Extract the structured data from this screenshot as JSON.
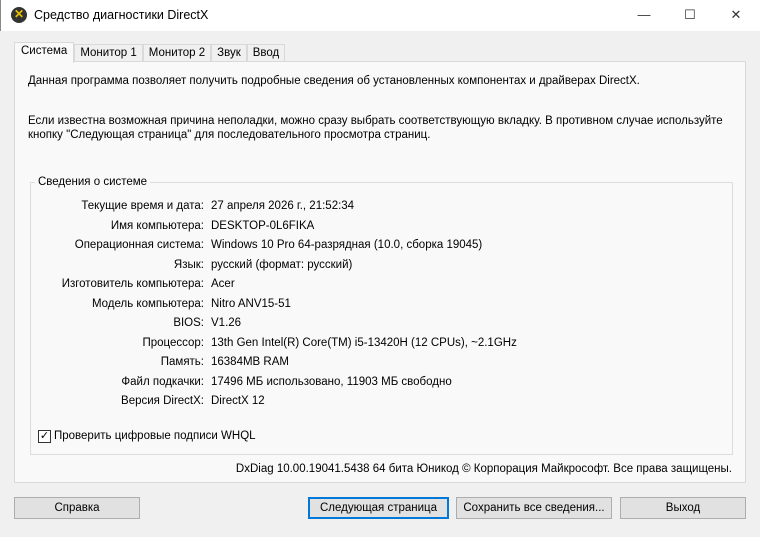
{
  "window": {
    "title": "Средство диагностики DirectX",
    "minimize": "—",
    "maximize": "☐",
    "close": "✕"
  },
  "tabs": [
    "Система",
    "Монитор 1",
    "Монитор 2",
    "Звук",
    "Ввод"
  ],
  "intro": "Данная программа позволяет получить подробные сведения об установленных компонентах и драйверах DirectX.",
  "hint": "Если известна возможная причина неполадки, можно сразу выбрать соответствующую вкладку. В противном случае используйте кнопку \"Следующая страница\" для последовательного просмотра страниц.",
  "group_title": "Сведения о системе",
  "rows": [
    {
      "label": "Текущие время и дата:",
      "value": "27 апреля 2026 г., 21:52:34"
    },
    {
      "label": "Имя компьютера:",
      "value": "DESKTOP-0L6FIKA"
    },
    {
      "label": "Операционная система:",
      "value": "Windows 10 Pro 64-разрядная (10.0, сборка 19045)"
    },
    {
      "label": "Язык:",
      "value": "русский (формат: русский)"
    },
    {
      "label": "Изготовитель компьютера:",
      "value": "Acer"
    },
    {
      "label": "Модель компьютера:",
      "value": "Nitro ANV15-51"
    },
    {
      "label": "BIOS:",
      "value": "V1.26"
    },
    {
      "label": "Процессор:",
      "value": "13th Gen Intel(R) Core(TM) i5-13420H (12 CPUs), ~2.1GHz"
    },
    {
      "label": "Память:",
      "value": "16384MB RAM"
    },
    {
      "label": "Файл подкачки:",
      "value": "17496 МБ использовано, 11903 МБ свободно"
    },
    {
      "label": "Версия DirectX:",
      "value": "DirectX 12"
    }
  ],
  "whql": {
    "label": "Проверить цифровые подписи WHQL",
    "checked": true,
    "mark": "✓"
  },
  "footer": "DxDiag 10.00.19041.5438 64 бита Юникод © Корпорация Майкрософт. Все права защищены.",
  "buttons": {
    "help": "Справка",
    "next": "Следующая страница",
    "save": "Сохранить все сведения...",
    "exit": "Выход"
  }
}
